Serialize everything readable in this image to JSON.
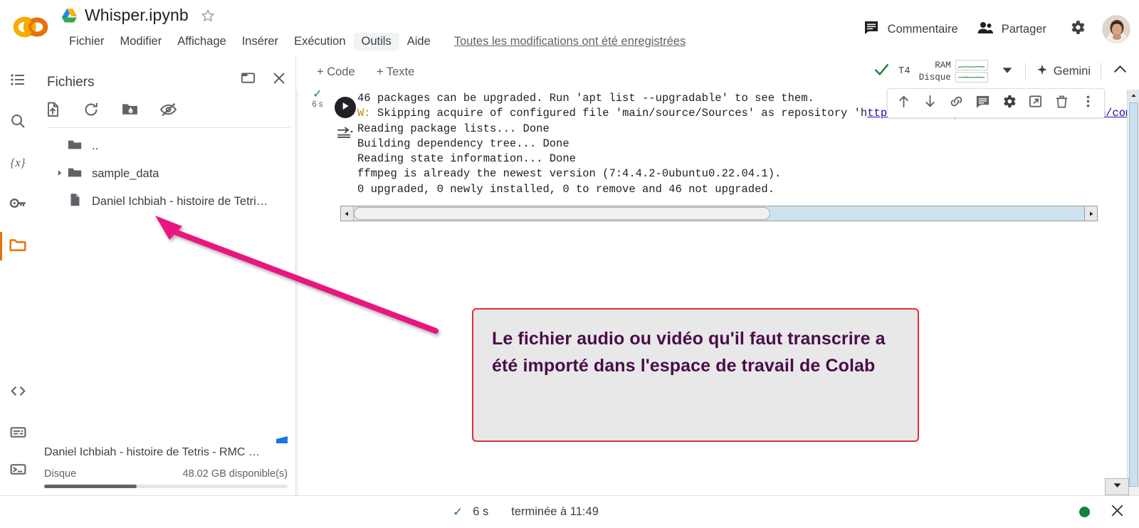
{
  "header": {
    "logo": "colab-logo",
    "drive_icon": "google-drive-icon",
    "notebook_title": "Whisper.ipynb",
    "star_icon": "star-icon",
    "menu": [
      "Fichier",
      "Modifier",
      "Affichage",
      "Insérer",
      "Exécution",
      "Outils",
      "Aide"
    ],
    "active_menu": "Outils",
    "save_status": "Toutes les modifications ont été enregistrées",
    "comment_label": "Commentaire",
    "share_label": "Partager",
    "comment_icon": "comment-icon",
    "share_icon": "people-icon",
    "settings_icon": "gear-icon",
    "avatar": "user-avatar"
  },
  "rail": {
    "items": [
      {
        "name": "toc-icon",
        "label": "Table des matières",
        "selected": false
      },
      {
        "name": "search-icon",
        "label": "Rechercher",
        "selected": false
      },
      {
        "name": "variables-icon",
        "label": "Variables",
        "selected": false
      },
      {
        "name": "key-icon",
        "label": "Secrets",
        "selected": false
      },
      {
        "name": "folder-icon",
        "label": "Fichiers",
        "selected": true
      },
      {
        "name": "code-snippets-icon",
        "label": "Extraits de code",
        "selected": false
      },
      {
        "name": "command-palette-icon",
        "label": "Palette de commandes",
        "selected": false
      },
      {
        "name": "terminal-icon",
        "label": "Terminal",
        "selected": false
      }
    ],
    "active_color": "#e8710a"
  },
  "files_panel": {
    "title": "Fichiers",
    "collapse_icon": "panel-collapse-icon",
    "close_icon": "close-icon",
    "toolbar": [
      {
        "name": "upload-file-icon",
        "label": "Importer dans l'espace de stockage de la session"
      },
      {
        "name": "refresh-icon",
        "label": "Actualiser"
      },
      {
        "name": "mount-drive-icon",
        "label": "Installer Google Drive"
      },
      {
        "name": "toggle-hidden-icon",
        "label": "Afficher/masquer les fichiers masqués"
      }
    ],
    "tree": [
      {
        "label": "..",
        "type": "parent-folder",
        "expandable": false
      },
      {
        "label": "sample_data",
        "type": "folder",
        "expandable": true
      },
      {
        "label": "Daniel Ichbiah - histoire de Tetris …",
        "type": "file",
        "expandable": false
      }
    ],
    "footer": {
      "file_name": "Daniel Ichbiah - histoire de Tetris - RMC …",
      "disk_label": "Disque",
      "disk_value": "48.02 GB disponible(s)",
      "disk_used_percent": 38
    }
  },
  "notebook_toolbar": {
    "add_code": "+ Code",
    "add_text": "+ Texte",
    "connected_check": "check-icon",
    "runtime_type": "T4",
    "ram_label": "RAM",
    "disk_label": "Disque",
    "dropdown_icon": "chevron-down-icon",
    "gemini_label": "Gemini",
    "gemini_icon": "sparkle-icon",
    "collapse_icon": "chevron-up-icon"
  },
  "cell": {
    "status_check": "check-icon",
    "run_time": "6 s",
    "run_icon": "play-icon",
    "output_toggle_icon": "output-collapse-icon",
    "output_lines": [
      "46 packages can be upgraded. Run 'apt list --upgradable' to see them.",
      "W: Skipping acquire of configured file 'main/source/Sources' as repository 'h",
      "Reading package lists... Done",
      "Building dependency tree... Done",
      "Reading state information... Done",
      "ffmpeg is already the newest version (7:4.4.2-0ubuntu0.22.04.1).",
      "0 upgraded, 0 newly installed, 0 to remove and 46 not upgraded."
    ],
    "warning_prefix": "W:",
    "toolbar_icons": [
      {
        "name": "move-cell-up-icon",
        "label": "Déplacer la cellule vers le haut"
      },
      {
        "name": "move-cell-down-icon",
        "label": "Déplacer la cellule vers le bas"
      },
      {
        "name": "link-to-cell-icon",
        "label": "Lien vers la cellule"
      },
      {
        "name": "add-comment-icon",
        "label": "Ajouter un commentaire"
      },
      {
        "name": "cell-settings-icon",
        "label": "Paramètres de la cellule"
      },
      {
        "name": "mirror-cell-icon",
        "label": "Dupliquer la cellule"
      },
      {
        "name": "delete-cell-icon",
        "label": "Supprimer la cellule"
      },
      {
        "name": "more-options-icon",
        "label": "Plus d'options"
      }
    ]
  },
  "annotation": {
    "text": "Le fichier audio ou vidéo qu'il faut transcrire a été importé dans l'espace de travail de Colab",
    "box_bg": "#e8e8e8",
    "box_border": "#e03030",
    "text_color": "#4a0d4a",
    "arrow_color": "#e8157e"
  },
  "status_bar": {
    "check_icon": "check-icon",
    "duration": "6 s",
    "finished_text": "terminée à 11:49",
    "connection_dot": "#188038",
    "close_icon": "close-icon",
    "dropdown_icon": "chevron-down-icon"
  }
}
